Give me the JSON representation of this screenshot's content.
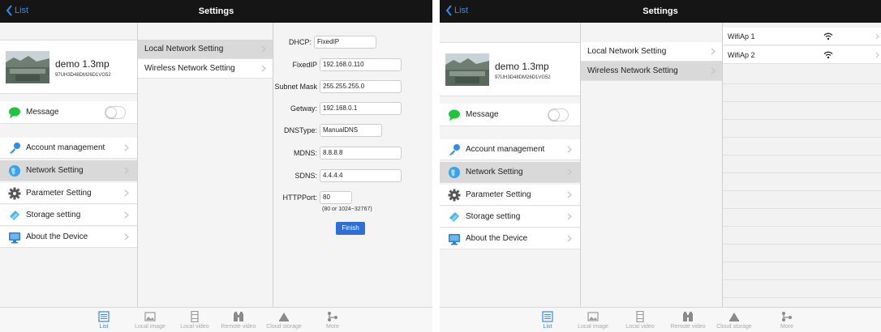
{
  "colors": {
    "navbar_bg": "#151515",
    "accent_blue": "#2f8df3",
    "message_green": "#1fc63a",
    "finish_button": "#2d6fd6",
    "tab_active": "#3b86e0"
  },
  "screenA": {
    "nav": {
      "back_label": "List",
      "title": "Settings"
    },
    "device": {
      "name": "demo 1.3mp",
      "uid": "97UH3D48DM26D1VG52"
    },
    "message": {
      "label": "Message",
      "toggle_on": false
    },
    "menu": [
      {
        "label": "Account management",
        "icon": "key-icon"
      },
      {
        "label": "Network Setting",
        "icon": "globe-icon",
        "selected": true
      },
      {
        "label": "Parameter Setting",
        "icon": "gear-icon"
      },
      {
        "label": "Storage setting",
        "icon": "storage-icon"
      },
      {
        "label": "About the Device",
        "icon": "monitor-icon"
      }
    ],
    "submenu": [
      {
        "label": "Local Network Setting",
        "selected": true
      },
      {
        "label": "Wireless Network Setting"
      }
    ],
    "form": {
      "dhcp_label": "DHCP:",
      "dhcp_value": "FixedIP",
      "fixedip_label": "FixedIP",
      "fixedip_value": "192.168.0.110",
      "subnet_label": "Subnet Mask",
      "subnet_value": "255.255.255.0",
      "gateway_label": "Getway:",
      "gateway_value": "192.168.0.1",
      "dnstype_label": "DNSType:",
      "dnstype_value": "ManualDNS",
      "mdns_label": "MDNS:",
      "mdns_value": "8.8.8.8",
      "sdns_label": "SDNS:",
      "sdns_value": "4.4.4.4",
      "httpport_label": "HTTPPort:",
      "httpport_value": "80",
      "httpport_hint": "(80 or 1024~32767)",
      "finish_label": "Finish"
    },
    "tabs": [
      "List",
      "Local image",
      "Local video",
      "Remote video",
      "Cloud storage",
      "More"
    ]
  },
  "screenB": {
    "nav": {
      "back_label": "List",
      "title": "Settings"
    },
    "device": {
      "name": "demo 1.3mp",
      "uid": "97UH3D48DM26D1VG52"
    },
    "message": {
      "label": "Message",
      "toggle_on": false
    },
    "menu": [
      {
        "label": "Account management",
        "icon": "key-icon"
      },
      {
        "label": "Network Setting",
        "icon": "globe-icon",
        "selected": true
      },
      {
        "label": "Parameter Setting",
        "icon": "gear-icon"
      },
      {
        "label": "Storage setting",
        "icon": "storage-icon"
      },
      {
        "label": "About the Device",
        "icon": "monitor-icon"
      }
    ],
    "submenu": [
      {
        "label": "Local Network Setting"
      },
      {
        "label": "Wireless Network Setting",
        "selected": true
      }
    ],
    "wifi": [
      {
        "ssid": "WifiAp 1",
        "icon": "wifi-icon"
      },
      {
        "ssid": "WifiAp 2",
        "icon": "wifi-icon"
      }
    ],
    "tabs": [
      "List",
      "Local image",
      "Local video",
      "Remote video",
      "Cloud storage",
      "More"
    ]
  }
}
